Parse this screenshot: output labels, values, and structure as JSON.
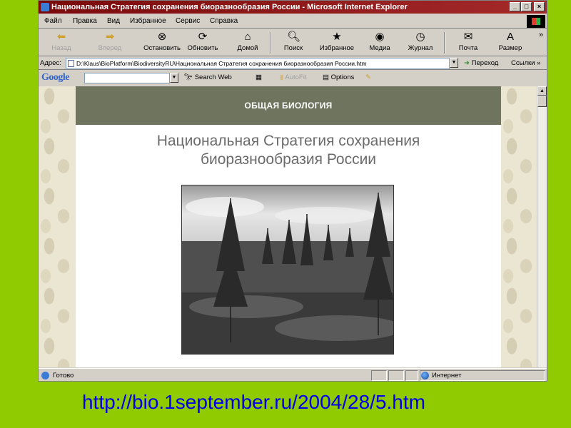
{
  "window": {
    "title": "Национальная Стратегия сохранения биоразнообразия России - Microsoft Internet Explorer",
    "controls": {
      "minimize": "_",
      "maximize": "□",
      "close": "×"
    }
  },
  "menu": [
    "Файл",
    "Правка",
    "Вид",
    "Избранное",
    "Сервис",
    "Справка"
  ],
  "toolbar": {
    "back": "Назад",
    "forward": "Вперед",
    "stop": "Остановить",
    "refresh": "Обновить",
    "home": "Домой",
    "search": "Поиск",
    "favorites": "Избранное",
    "media": "Медиа",
    "history": "Журнал",
    "mail": "Почта",
    "size": "Размер",
    "more": "»"
  },
  "address": {
    "label": "Адрес:",
    "value": "D:\\Klaus\\BioPlatform\\BiodiversityRU\\Национальная Стратегия сохранения биоразнообразия России.htm",
    "go": "Переход",
    "links": "Ссылки",
    "more": "»"
  },
  "google": {
    "logo": "Google",
    "search_label": "Search Web",
    "autofit": "AutoFit",
    "options": "Options"
  },
  "page": {
    "section": "ОБЩАЯ БИОЛОГИЯ",
    "heading_line1": "Национальная Стратегия сохранения",
    "heading_line2": "биоразнообразия России"
  },
  "status": {
    "text": "Готово",
    "zone": "Интернет"
  },
  "slide": {
    "url": "http://bio.1september.ru/2004/28/5.htm"
  },
  "colors": {
    "slide_background": "#8fcb00",
    "title_bar": "#7a0a0a",
    "section_header": "#6e745d",
    "heading_text": "#6b6b6b",
    "url_text": "#0000ee"
  }
}
